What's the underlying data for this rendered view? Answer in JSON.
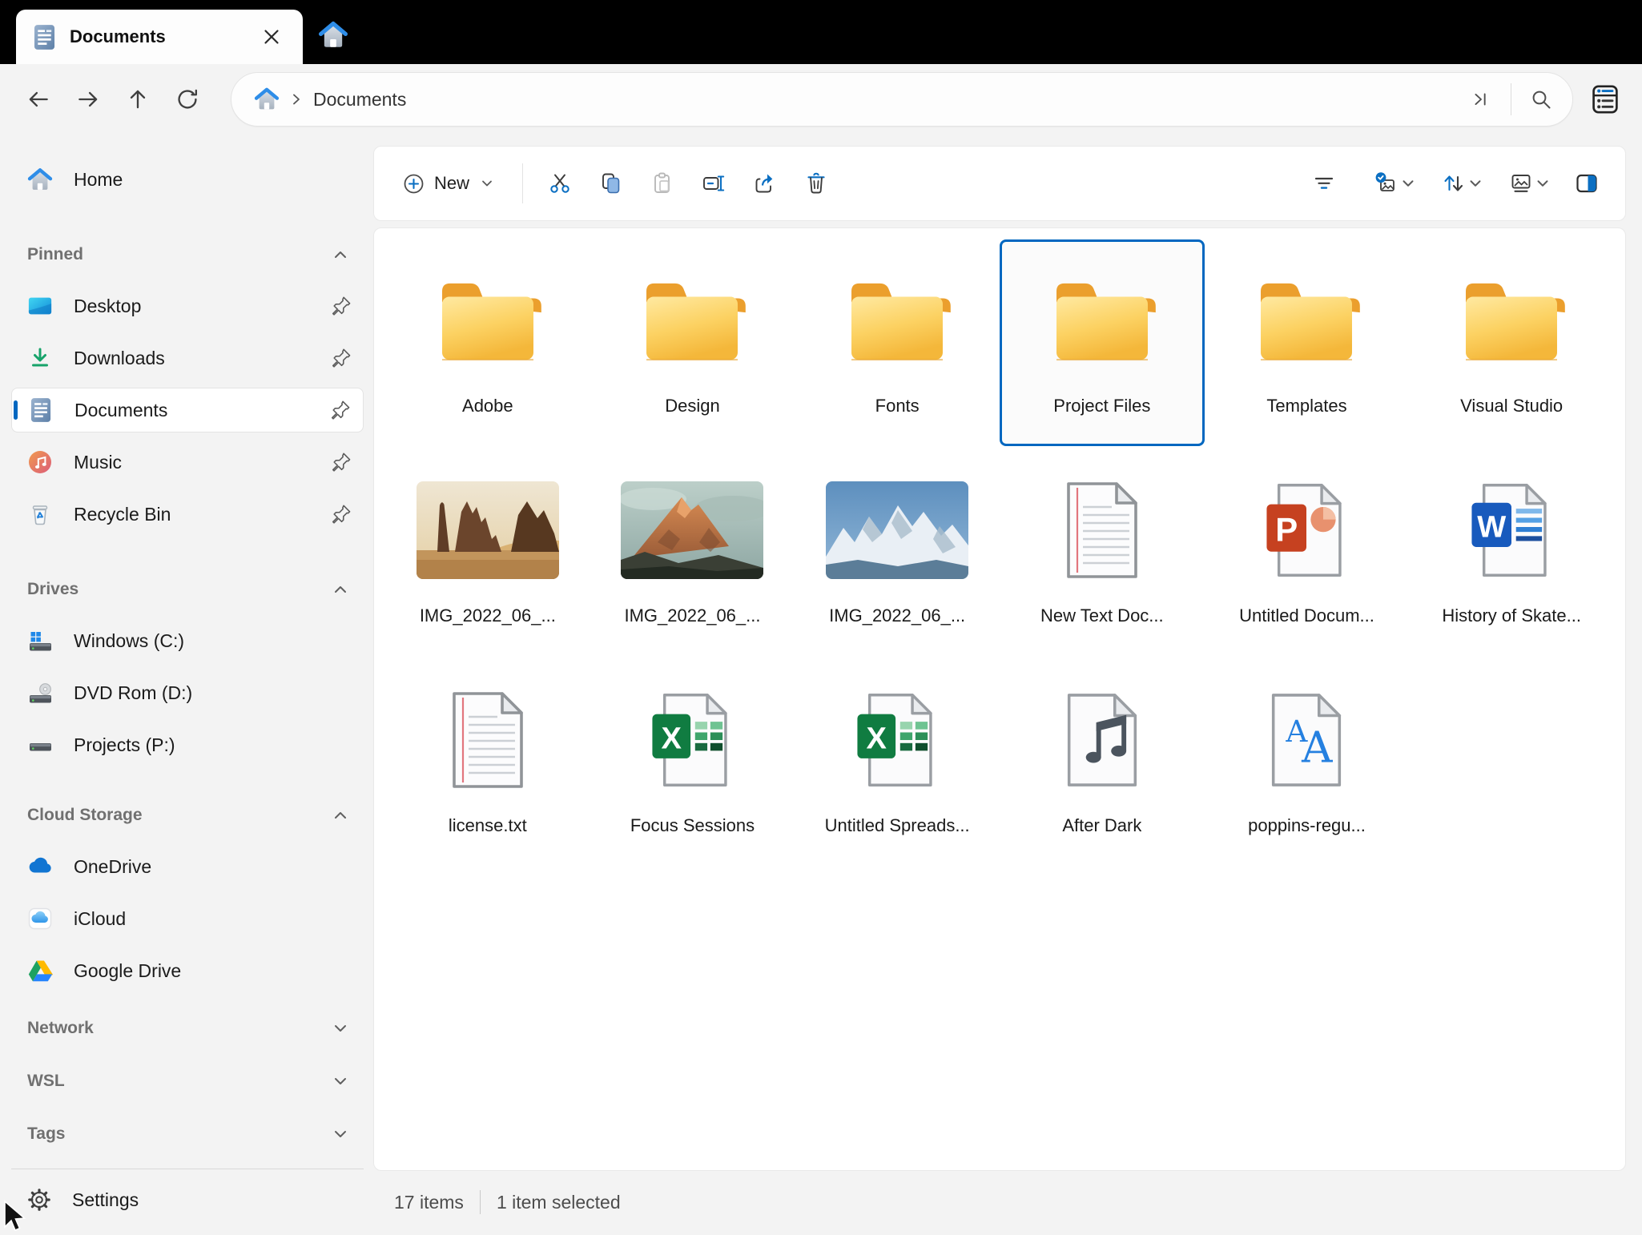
{
  "window": {
    "tab_title": "Documents"
  },
  "nav": {
    "breadcrumb_item": "Documents"
  },
  "toolbar": {
    "new_label": "New"
  },
  "sidebar": {
    "home_label": "Home",
    "sections": {
      "pinned": {
        "label": "Pinned",
        "items": [
          {
            "label": "Desktop"
          },
          {
            "label": "Downloads"
          },
          {
            "label": "Documents",
            "selected": true
          },
          {
            "label": "Music"
          },
          {
            "label": "Recycle Bin"
          }
        ]
      },
      "drives": {
        "label": "Drives",
        "items": [
          {
            "label": "Windows (C:)"
          },
          {
            "label": "DVD Rom (D:)"
          },
          {
            "label": "Projects (P:)"
          }
        ]
      },
      "cloud": {
        "label": "Cloud Storage",
        "items": [
          {
            "label": "OneDrive"
          },
          {
            "label": "iCloud"
          },
          {
            "label": "Google Drive"
          }
        ]
      },
      "collapsed": [
        {
          "label": "Network"
        },
        {
          "label": "WSL"
        },
        {
          "label": "Tags"
        }
      ]
    },
    "settings_label": "Settings"
  },
  "files": {
    "items": [
      {
        "label": "Adobe",
        "type": "folder"
      },
      {
        "label": "Design",
        "type": "folder"
      },
      {
        "label": "Fonts",
        "type": "folder"
      },
      {
        "label": "Project Files",
        "type": "folder",
        "selected": true
      },
      {
        "label": "Templates",
        "type": "folder"
      },
      {
        "label": "Visual Studio",
        "type": "folder"
      },
      {
        "label": "IMG_2022_06_...",
        "type": "photo-desert"
      },
      {
        "label": "IMG_2022_06_...",
        "type": "photo-alpine"
      },
      {
        "label": "IMG_2022_06_...",
        "type": "photo-snow"
      },
      {
        "label": "New Text Doc...",
        "type": "textfile"
      },
      {
        "label": "Untitled Docum...",
        "type": "powerpoint"
      },
      {
        "label": "History of Skate...",
        "type": "word"
      },
      {
        "label": "license.txt",
        "type": "textfile"
      },
      {
        "label": "Focus Sessions",
        "type": "excel"
      },
      {
        "label": "Untitled Spreads...",
        "type": "excel"
      },
      {
        "label": "After Dark",
        "type": "music"
      },
      {
        "label": "poppins-regu...",
        "type": "font"
      }
    ]
  },
  "statusbar": {
    "items_count": "17 items",
    "selection": "1 item selected"
  },
  "colors": {
    "accent": "#0067c0",
    "titlebar": "#000000",
    "window_bg": "#f3f3f3",
    "card_bg": "#ffffff",
    "folder_yellow": "#f6bd3f",
    "excel_green": "#107c41",
    "word_blue": "#185abd",
    "powerpoint_red": "#c64120"
  },
  "icons": {
    "tab": "document-icon",
    "newtab": "home-icon",
    "nav": [
      "back-arrow-icon",
      "forward-arrow-icon",
      "up-arrow-icon",
      "refresh-icon"
    ],
    "addressbar": [
      "home-icon",
      "chevron-right-icon",
      "jump-to-end-icon",
      "search-icon",
      "tasks-icon"
    ],
    "toolbar_left": [
      "plus-circle-icon",
      "cut-icon",
      "copy-icon",
      "paste-icon",
      "rename-icon",
      "share-icon",
      "delete-icon"
    ],
    "toolbar_right": [
      "filter-icon",
      "select-options-icon",
      "sort-icon",
      "layout-view-icon",
      "details-pane-icon"
    ],
    "sidebar": [
      "home-icon",
      "desktop-icon",
      "downloads-icon",
      "documents-icon",
      "music-icon",
      "recycle-bin-icon",
      "windows-drive-icon",
      "dvd-drive-icon",
      "drive-icon",
      "onedrive-icon",
      "icloud-icon",
      "google-drive-icon",
      "gear-icon",
      "pin-icon",
      "chevron-up-icon",
      "chevron-down-icon"
    ]
  }
}
